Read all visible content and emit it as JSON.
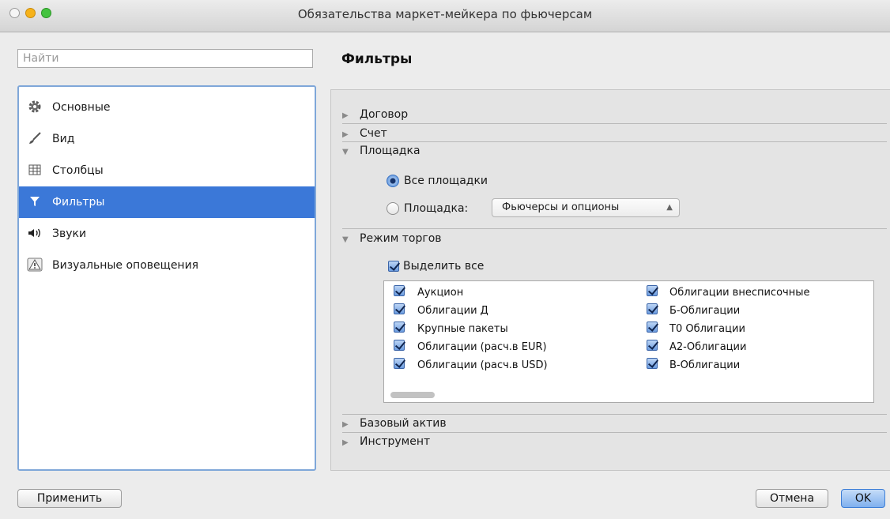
{
  "window": {
    "title": "Обязательства маркет-мейкера по фьючерсам"
  },
  "search": {
    "placeholder": "Найти",
    "value": ""
  },
  "sidebar": {
    "items": [
      {
        "label": "Основные",
        "icon": "gear-icon",
        "selected": false
      },
      {
        "label": "Вид",
        "icon": "brush-icon",
        "selected": false
      },
      {
        "label": "Столбцы",
        "icon": "table-icon",
        "selected": false
      },
      {
        "label": "Фильтры",
        "icon": "filter-icon",
        "selected": true
      },
      {
        "label": "Звуки",
        "icon": "speaker-icon",
        "selected": false
      },
      {
        "label": "Визуальные оповещения",
        "icon": "warning-icon",
        "selected": false
      }
    ]
  },
  "main": {
    "heading": "Фильтры",
    "sections": [
      {
        "label": "Договор",
        "expanded": false
      },
      {
        "label": "Счет",
        "expanded": false
      },
      {
        "label": "Площадка",
        "expanded": true
      },
      {
        "label": "Режим торгов",
        "expanded": true
      },
      {
        "label": "Базовый актив",
        "expanded": false
      },
      {
        "label": "Инструмент",
        "expanded": false
      }
    ],
    "platform": {
      "radio_all": "Все площадки",
      "radio_one": "Площадка:",
      "selected": "all",
      "select_value": "Фьючерсы и опционы"
    },
    "trading_mode": {
      "select_all": "Выделить все",
      "items": [
        {
          "label": "Аукцион",
          "checked": true
        },
        {
          "label": "Облигации Д",
          "checked": true
        },
        {
          "label": "Крупные пакеты",
          "checked": true
        },
        {
          "label": "Облигации (расч.в EUR)",
          "checked": true
        },
        {
          "label": "Облигации (расч.в USD)",
          "checked": true
        },
        {
          "label": "Облигации внесписочные",
          "checked": true
        },
        {
          "label": "Б-Облигации",
          "checked": true
        },
        {
          "label": "Т0 Облигации",
          "checked": true
        },
        {
          "label": "А2-Облигации",
          "checked": true
        },
        {
          "label": "В-Облигации",
          "checked": true
        }
      ]
    }
  },
  "footer": {
    "apply_label": "Применить",
    "cancel_label": "Отмена",
    "ok_label": "OK"
  },
  "colors": {
    "selection": "#3b78d8",
    "accent_button": "#7fb0ee"
  }
}
